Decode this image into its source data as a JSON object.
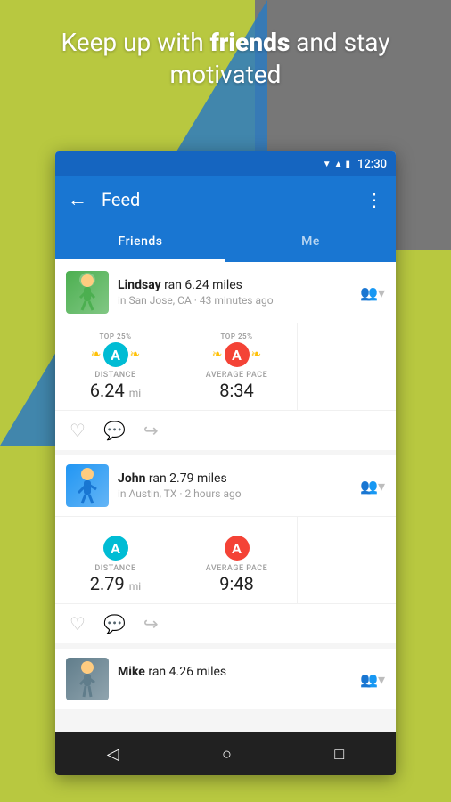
{
  "background": {
    "motivational_line1": "Keep up with ",
    "motivational_bold": "friends",
    "motivational_line2": " and stay motivated"
  },
  "status_bar": {
    "time": "12:30"
  },
  "top_bar": {
    "back_label": "←",
    "title": "Feed",
    "more_label": "⋮"
  },
  "tabs": [
    {
      "label": "Friends",
      "active": true
    },
    {
      "label": "Me",
      "active": false
    }
  ],
  "feed_items": [
    {
      "id": "lindsay",
      "user": "Lindsay",
      "action": "ran 6.24 miles",
      "location": "in San Jose, CA",
      "time": "43 minutes ago",
      "stats": [
        {
          "badge_top": "TOP 25%",
          "badge_letter": "A",
          "badge_color": "teal",
          "label": "DISTANCE",
          "value": "6.24",
          "unit": "mi"
        },
        {
          "badge_top": "TOP 25%",
          "badge_letter": "A",
          "badge_color": "red",
          "label": "AVERAGE PACE",
          "value": "8:34",
          "unit": ""
        }
      ]
    },
    {
      "id": "john",
      "user": "John",
      "action": "ran 2.79 miles",
      "location": "in Austin, TX",
      "time": "2 hours ago",
      "stats": [
        {
          "badge_top": "",
          "badge_letter": "A",
          "badge_color": "teal",
          "label": "DISTANCE",
          "value": "2.79",
          "unit": "mi"
        },
        {
          "badge_top": "",
          "badge_letter": "A",
          "badge_color": "red",
          "label": "AVERAGE PACE",
          "value": "9:48",
          "unit": ""
        }
      ]
    },
    {
      "id": "mike",
      "user": "Mike",
      "action": "ran 4.26 miles",
      "location": "",
      "time": "",
      "stats": []
    }
  ],
  "bottom_nav": {
    "back": "◁",
    "home": "○",
    "recent": "□"
  }
}
